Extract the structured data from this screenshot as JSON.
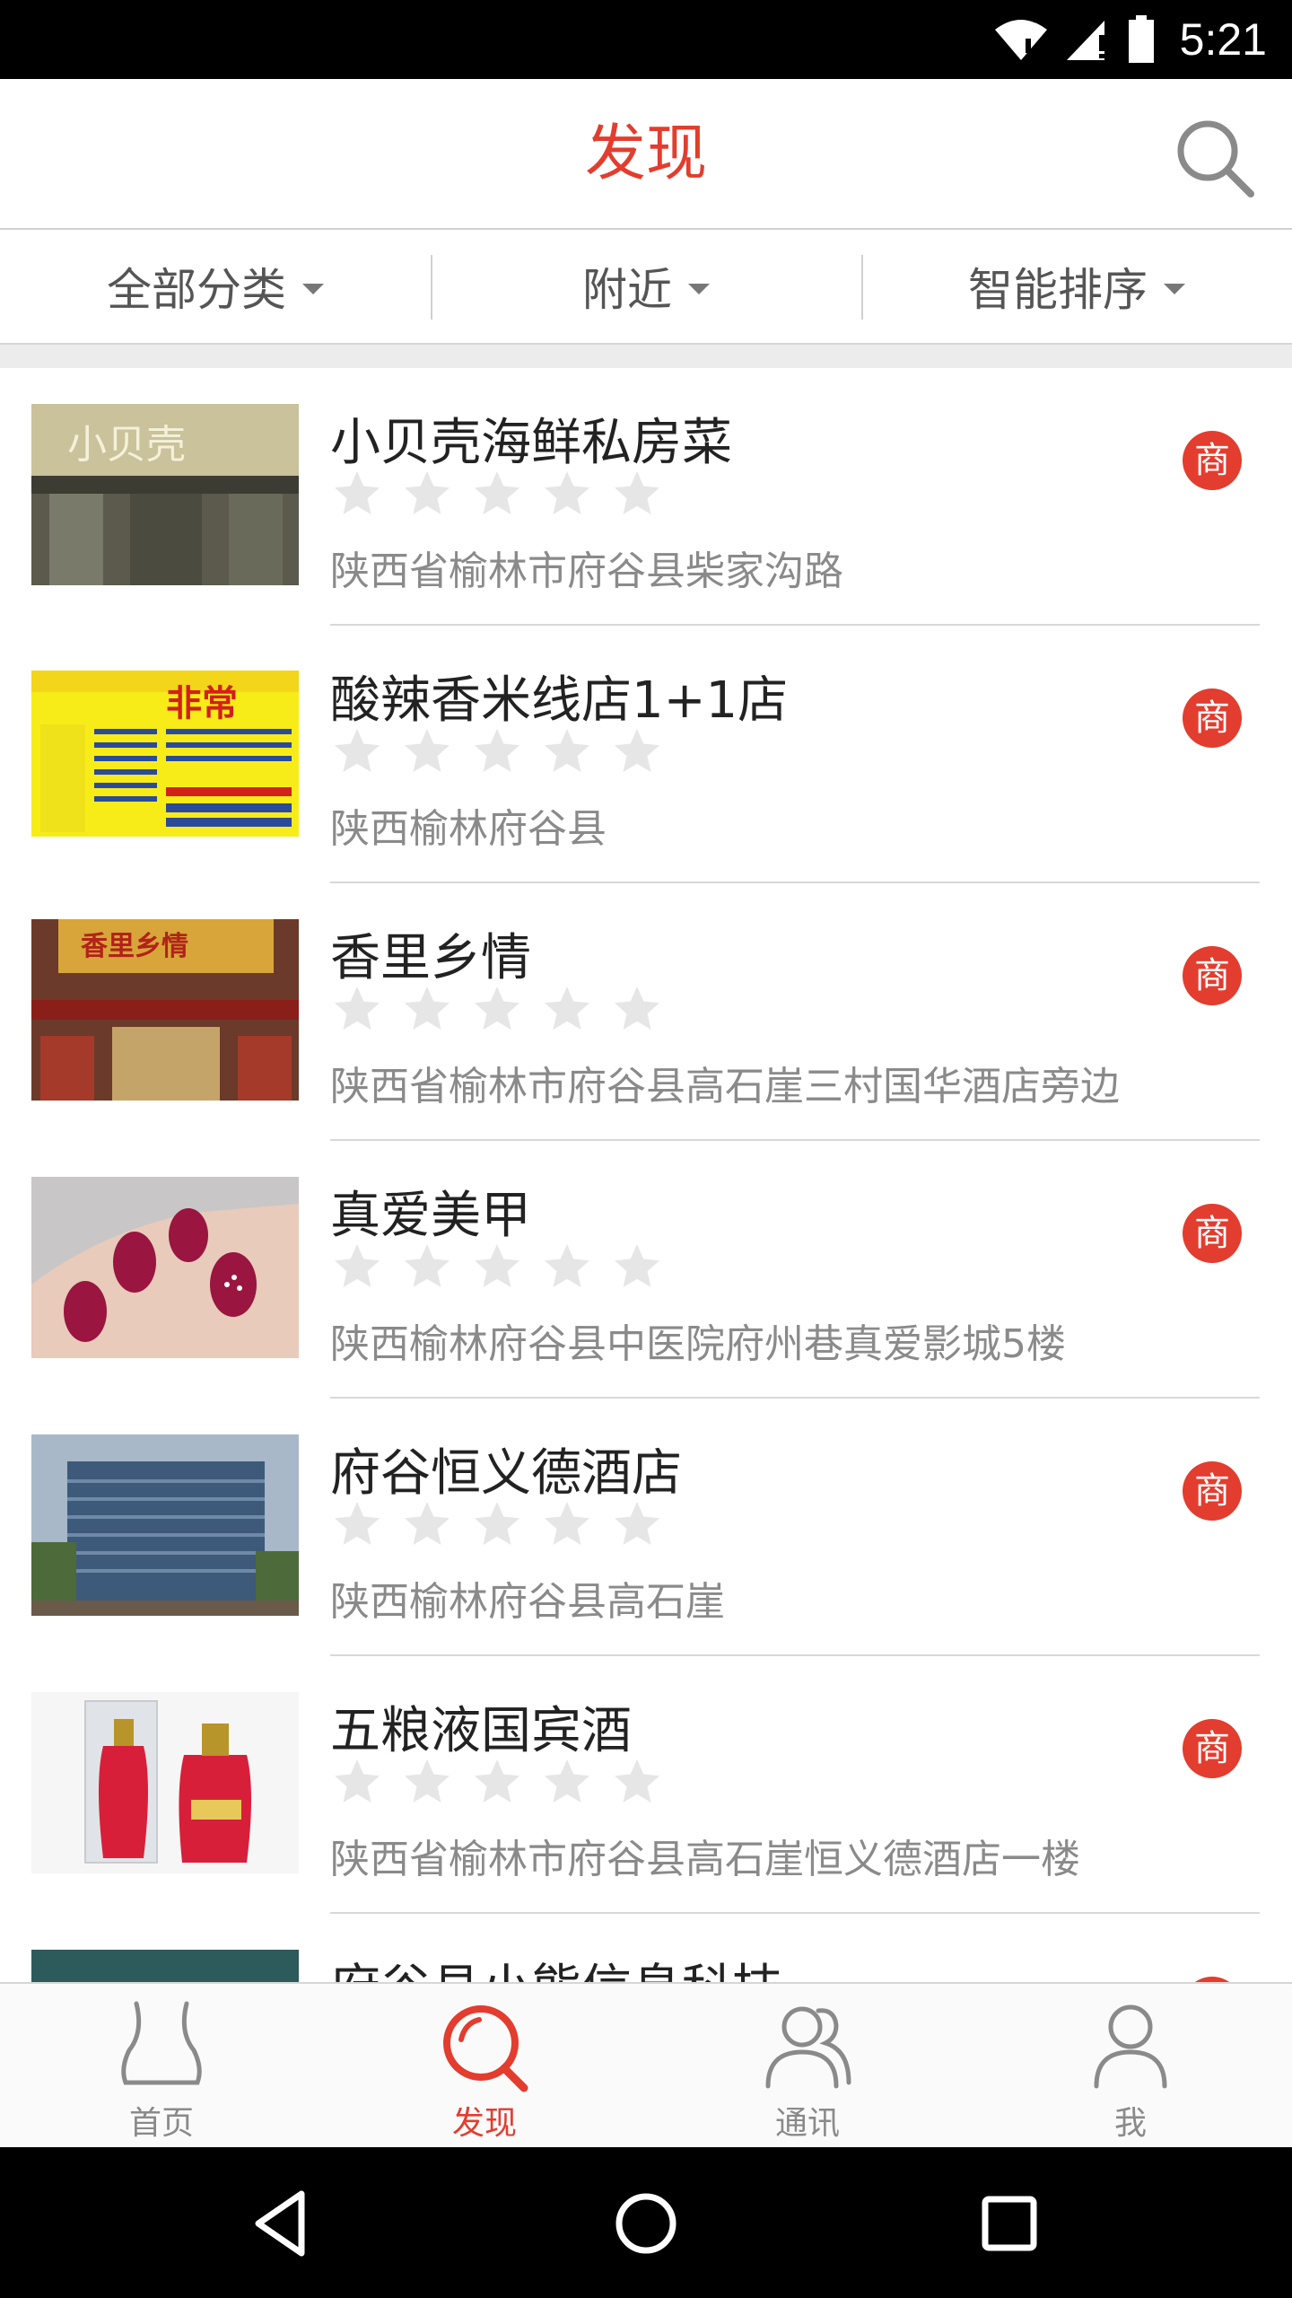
{
  "status_bar": {
    "time": "5:21"
  },
  "header": {
    "title": "发现"
  },
  "filters": [
    {
      "label": "全部分类"
    },
    {
      "label": "附近"
    },
    {
      "label": "智能排序"
    }
  ],
  "merchants": [
    {
      "name": "小贝壳海鲜私房菜",
      "address": "陕西省榆林市府谷县柴家沟路",
      "badge": "商",
      "rating": 0,
      "thumb_text": "小贝壳"
    },
    {
      "name": "酸辣香米线店1+1店",
      "address": "陕西榆林府谷县",
      "badge": "商",
      "rating": 0,
      "thumb_text": "非常"
    },
    {
      "name": "香里乡情",
      "address": "陕西省榆林市府谷县高石崖三村国华酒店旁边",
      "badge": "商",
      "rating": 0,
      "thumb_text": "香里乡情"
    },
    {
      "name": "真爱美甲",
      "address": "陕西榆林府谷县中医院府州巷真爱影城5楼",
      "badge": "商",
      "rating": 0,
      "thumb_text": ""
    },
    {
      "name": "府谷恒义德酒店",
      "address": "陕西榆林府谷县高石崖",
      "badge": "商",
      "rating": 0,
      "thumb_text": ""
    },
    {
      "name": "五粮液国宾酒",
      "address": "陕西省榆林市府谷县高石崖恒义德酒店一楼",
      "badge": "商",
      "rating": 0,
      "thumb_text": ""
    },
    {
      "name": "府谷县小熊信息科技",
      "address": "",
      "badge": "商",
      "rating": 0,
      "thumb_text": ""
    }
  ],
  "bottom_nav": [
    {
      "label": "首页",
      "icon": "home-icon"
    },
    {
      "label": "发现",
      "icon": "discover-icon",
      "active": true
    },
    {
      "label": "通讯",
      "icon": "contacts-icon"
    },
    {
      "label": "我",
      "icon": "profile-icon"
    }
  ],
  "colors": {
    "accent": "#e23d2e",
    "star": "#e6e6e6"
  }
}
